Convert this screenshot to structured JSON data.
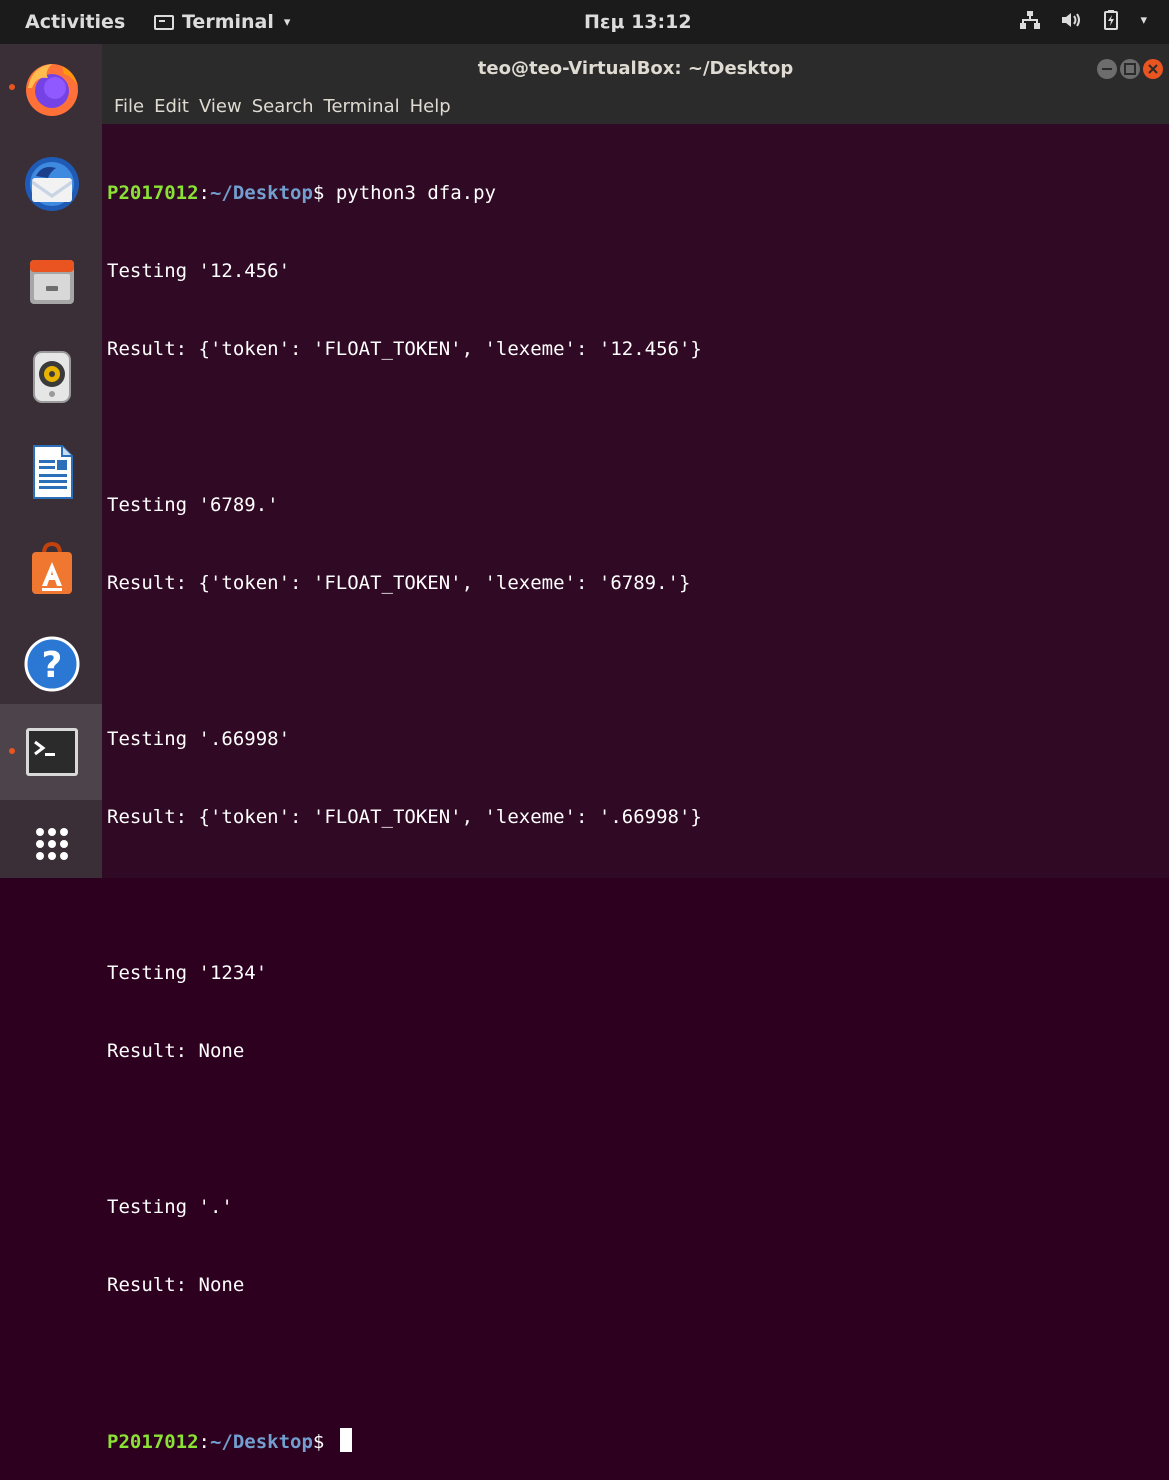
{
  "topbar": {
    "activities": "Activities",
    "app_menu": "Terminal",
    "app_menu_caret": "▾",
    "clock": "Πεμ 13:12",
    "tray_caret": "▾"
  },
  "dock": {
    "items": [
      {
        "name": "firefox",
        "running": true
      },
      {
        "name": "thunderbird",
        "running": false
      },
      {
        "name": "files",
        "running": false
      },
      {
        "name": "rhythmbox",
        "running": false
      },
      {
        "name": "libreoffice-writer",
        "running": false
      },
      {
        "name": "software-center",
        "running": false
      },
      {
        "name": "help",
        "running": false
      },
      {
        "name": "terminal",
        "running": true,
        "active": true
      },
      {
        "name": "show-applications",
        "running": false
      }
    ]
  },
  "window": {
    "title": "teo@teo-VirtualBox: ~/Desktop",
    "menu": [
      "File",
      "Edit",
      "View",
      "Search",
      "Terminal",
      "Help"
    ]
  },
  "terminal": {
    "prompt_user": "P2017012",
    "prompt_sep": ":",
    "prompt_path": "~/Desktop",
    "prompt_symbol": "$",
    "command": "python3 dfa.py",
    "output": [
      "Testing '12.456'",
      "Result: {'token': 'FLOAT_TOKEN', 'lexeme': '12.456'}",
      "",
      "Testing '6789.'",
      "Result: {'token': 'FLOAT_TOKEN', 'lexeme': '6789.'}",
      "",
      "Testing '.66998'",
      "Result: {'token': 'FLOAT_TOKEN', 'lexeme': '.66998'}",
      "",
      "Testing '1234'",
      "Result: None",
      "",
      "Testing '.'",
      "Result: None",
      ""
    ]
  },
  "colors": {
    "terminal_bg": "#300a24",
    "prompt_user": "#8ae234",
    "prompt_path": "#729fcf",
    "accent": "#e95420"
  }
}
